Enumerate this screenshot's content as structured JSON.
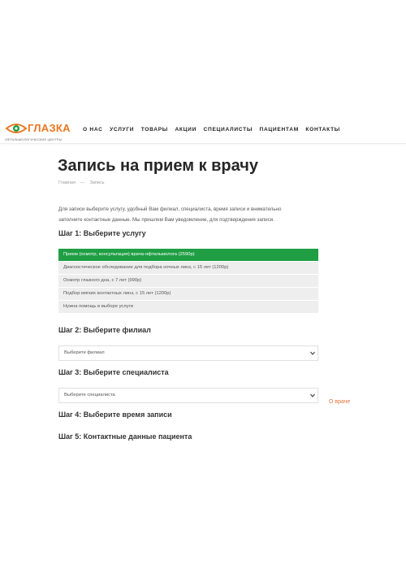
{
  "header": {
    "logo_text": "ГЛАЗКА",
    "logo_subtitle": "ОФТАЛЬМОЛОГИЧЕСКИЕ ЦЕНТРЫ",
    "nav": [
      {
        "label": "О НАС"
      },
      {
        "label": "УСЛУГИ"
      },
      {
        "label": "ТОВАРЫ"
      },
      {
        "label": "АКЦИИ"
      },
      {
        "label": "СПЕЦИАЛИСТЫ"
      },
      {
        "label": "ПАЦИЕНТАМ"
      },
      {
        "label": "КОНТАКТЫ"
      }
    ]
  },
  "page": {
    "title": "Запись на прием к врачу",
    "breadcrumb": {
      "home": "Главная",
      "separator": "—",
      "current": "Запись"
    },
    "intro": "Для записи выберите услугу, удобный Вам филиал, специалиста, время записи и внимательно заполните контактные данные. Мы пришлем Вам уведомление, для подтверждения записи."
  },
  "steps": {
    "step1": "Шаг 1: Выберите услугу",
    "step2": "Шаг 2: Выберите филиал",
    "step3": "Шаг 3: Выберите специалиста",
    "step4": "Шаг 4: Выберите время записи",
    "step5": "Шаг 5: Контактные данные пациента"
  },
  "services": [
    {
      "label": "Прием (осмотр, консультация) врача-офтальмолога (2590р)",
      "selected": true
    },
    {
      "label": "Диагностическое обследование для подбора ночных линз, с 15 лет (1200р)",
      "selected": false
    },
    {
      "label": "Осмотр глазного дна, с 7 лет (990р)",
      "selected": false
    },
    {
      "label": "Подбор мягких контактных линз, с 15 лет (1200р)",
      "selected": false
    },
    {
      "label": "Нужна помощь в выборе услуги",
      "selected": false
    }
  ],
  "branch_select": {
    "value": "Выберите филиал"
  },
  "specialist_select": {
    "value": "Выберите специалиста"
  },
  "about_doctor_link": "О враче",
  "colors": {
    "brand_orange": "#e87722",
    "selected_green": "#1f9e44",
    "link_orange": "#e8733c",
    "service_bg": "#eeeeee"
  },
  "icons": {
    "logo": "eye-logo-icon",
    "dropdown": "chevron-down-icon"
  }
}
